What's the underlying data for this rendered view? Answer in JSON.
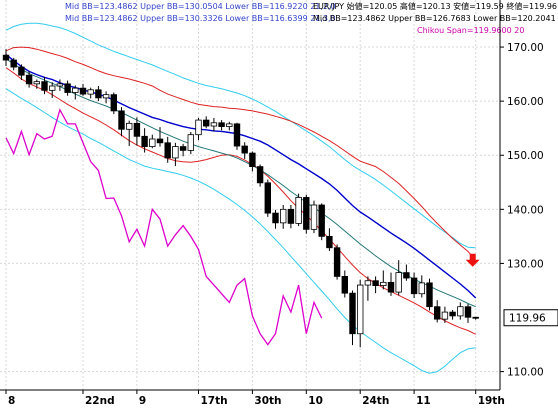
{
  "chart_data": {
    "type": "candlestick",
    "colors": {
      "background": "#ffffff",
      "grid": "#d8d8d8",
      "mid_bb_20": "#0000cc",
      "bb_20_band": "#dd2222",
      "mid_bb_21": "#227777",
      "bb_21_band": "#33ccee",
      "chikou": "#dd00cc",
      "up_candle": "#ffffff",
      "down_candle": "#000000",
      "current_price_box": "#000000",
      "arrow": "#ee1111"
    },
    "header_lines": [
      {
        "text": "Mid BB=123.4862 Upper BB=130.0504 Lower BB=116.9220  21,2,0",
        "color": "#3344cc"
      },
      {
        "text": "Mid BB=123.4862 Upper BB=130.3326 Lower BB=116.6399  21,3,0",
        "color": "#3344cc"
      },
      {
        "text": "EUR/JPY 始値=120.05 高値=120.13 安値=119.59 終値=119.96",
        "color": "#000000"
      },
      {
        "text": "Mid BB=123.4862 Upper BB=126.7683 Lower BB=120.2041  21,1,0",
        "color": "#000000"
      },
      {
        "text": "Chikou Span=119.9600  20",
        "color": "#cc00aa"
      }
    ],
    "y_ticks": [
      170,
      160,
      150,
      140,
      130,
      110
    ],
    "y_tick_labels": [
      "170.00",
      "160.00",
      "150.00",
      "140.00",
      "130.00",
      "110.00"
    ],
    "y_range": [
      106.6,
      178.7
    ],
    "current_price_label": "119.96",
    "current_price": 119.96,
    "x_labels": [
      {
        "i": 0,
        "label": "8"
      },
      {
        "i": 10,
        "label": "22nd"
      },
      {
        "i": 17,
        "label": "9"
      },
      {
        "i": 25,
        "label": "17th"
      },
      {
        "i": 32,
        "label": "30th"
      },
      {
        "i": 39,
        "label": "10"
      },
      {
        "i": 46,
        "label": "24th"
      },
      {
        "i": 53,
        "label": "11"
      },
      {
        "i": 61,
        "label": "19th"
      }
    ],
    "candles": [
      {
        "o": 168.5,
        "h": 169.6,
        "l": 166.5,
        "c": 167.6
      },
      {
        "o": 167.6,
        "h": 168.0,
        "l": 165.7,
        "c": 166.3
      },
      {
        "o": 166.3,
        "h": 166.8,
        "l": 163.9,
        "c": 164.8
      },
      {
        "o": 164.8,
        "h": 165.5,
        "l": 162.5,
        "c": 163.2
      },
      {
        "o": 163.2,
        "h": 164.0,
        "l": 162.3,
        "c": 163.6
      },
      {
        "o": 163.6,
        "h": 164.5,
        "l": 161.3,
        "c": 162.0
      },
      {
        "o": 162.0,
        "h": 163.5,
        "l": 160.6,
        "c": 162.8
      },
      {
        "o": 162.8,
        "h": 164.0,
        "l": 161.9,
        "c": 163.2
      },
      {
        "o": 163.2,
        "h": 163.8,
        "l": 161.0,
        "c": 161.6
      },
      {
        "o": 161.6,
        "h": 162.9,
        "l": 160.3,
        "c": 162.4
      },
      {
        "o": 162.4,
        "h": 163.2,
        "l": 161.0,
        "c": 161.3
      },
      {
        "o": 161.3,
        "h": 162.5,
        "l": 160.5,
        "c": 162.1
      },
      {
        "o": 162.1,
        "h": 162.8,
        "l": 160.0,
        "c": 160.6
      },
      {
        "o": 160.6,
        "h": 161.8,
        "l": 159.6,
        "c": 161.2
      },
      {
        "o": 161.2,
        "h": 161.6,
        "l": 157.6,
        "c": 158.2
      },
      {
        "o": 158.2,
        "h": 158.9,
        "l": 153.5,
        "c": 154.8
      },
      {
        "o": 154.8,
        "h": 156.4,
        "l": 151.7,
        "c": 155.9
      },
      {
        "o": 155.9,
        "h": 157.0,
        "l": 151.8,
        "c": 153.5
      },
      {
        "o": 153.5,
        "h": 155.0,
        "l": 150.5,
        "c": 151.6
      },
      {
        "o": 151.6,
        "h": 153.8,
        "l": 151.3,
        "c": 153.0
      },
      {
        "o": 153.0,
        "h": 155.2,
        "l": 151.6,
        "c": 152.3
      },
      {
        "o": 152.3,
        "h": 153.4,
        "l": 148.6,
        "c": 149.5
      },
      {
        "o": 149.5,
        "h": 152.3,
        "l": 148.0,
        "c": 151.6
      },
      {
        "o": 151.6,
        "h": 152.1,
        "l": 149.8,
        "c": 150.9
      },
      {
        "o": 150.9,
        "h": 154.3,
        "l": 150.2,
        "c": 153.8
      },
      {
        "o": 153.8,
        "h": 156.9,
        "l": 152.8,
        "c": 156.5
      },
      {
        "o": 156.5,
        "h": 157.2,
        "l": 155.0,
        "c": 155.4
      },
      {
        "o": 155.4,
        "h": 156.9,
        "l": 154.4,
        "c": 156.0
      },
      {
        "o": 156.0,
        "h": 156.5,
        "l": 154.6,
        "c": 155.3
      },
      {
        "o": 155.3,
        "h": 156.2,
        "l": 154.6,
        "c": 155.8
      },
      {
        "o": 155.8,
        "h": 156.0,
        "l": 151.0,
        "c": 151.7
      },
      {
        "o": 151.7,
        "h": 152.4,
        "l": 149.3,
        "c": 150.4
      },
      {
        "o": 150.4,
        "h": 150.7,
        "l": 147.0,
        "c": 147.9
      },
      {
        "o": 147.9,
        "h": 148.3,
        "l": 144.2,
        "c": 144.9
      },
      {
        "o": 144.9,
        "h": 145.5,
        "l": 138.6,
        "c": 139.3
      },
      {
        "o": 139.3,
        "h": 139.9,
        "l": 136.4,
        "c": 137.5
      },
      {
        "o": 137.5,
        "h": 140.8,
        "l": 136.4,
        "c": 140.0
      },
      {
        "o": 140.0,
        "h": 140.8,
        "l": 136.5,
        "c": 137.4
      },
      {
        "o": 137.4,
        "h": 142.9,
        "l": 136.9,
        "c": 142.2
      },
      {
        "o": 142.2,
        "h": 142.7,
        "l": 135.5,
        "c": 136.3
      },
      {
        "o": 136.3,
        "h": 141.6,
        "l": 135.6,
        "c": 140.8
      },
      {
        "o": 140.8,
        "h": 141.1,
        "l": 134.3,
        "c": 135.0
      },
      {
        "o": 135.0,
        "h": 136.5,
        "l": 132.3,
        "c": 132.9
      },
      {
        "o": 132.9,
        "h": 133.5,
        "l": 127.0,
        "c": 127.6
      },
      {
        "o": 127.6,
        "h": 128.7,
        "l": 123.7,
        "c": 124.5
      },
      {
        "o": 124.5,
        "h": 125.0,
        "l": 114.9,
        "c": 117.0
      },
      {
        "o": 117.0,
        "h": 127.0,
        "l": 114.5,
        "c": 126.0
      },
      {
        "o": 126.0,
        "h": 127.6,
        "l": 123.1,
        "c": 126.8
      },
      {
        "o": 126.8,
        "h": 127.6,
        "l": 124.5,
        "c": 125.9
      },
      {
        "o": 125.9,
        "h": 128.7,
        "l": 125.2,
        "c": 126.5
      },
      {
        "o": 126.5,
        "h": 128.3,
        "l": 124.0,
        "c": 124.7
      },
      {
        "o": 124.7,
        "h": 130.6,
        "l": 124.1,
        "c": 128.3
      },
      {
        "o": 128.3,
        "h": 129.8,
        "l": 126.8,
        "c": 127.3
      },
      {
        "o": 127.3,
        "h": 128.3,
        "l": 123.6,
        "c": 124.4
      },
      {
        "o": 124.4,
        "h": 127.8,
        "l": 123.7,
        "c": 126.4
      },
      {
        "o": 126.4,
        "h": 127.2,
        "l": 121.3,
        "c": 122.0
      },
      {
        "o": 122.0,
        "h": 123.2,
        "l": 119.1,
        "c": 119.7
      },
      {
        "o": 119.7,
        "h": 122.0,
        "l": 119.0,
        "c": 121.0
      },
      {
        "o": 121.0,
        "h": 121.4,
        "l": 119.6,
        "c": 120.3
      },
      {
        "o": 120.3,
        "h": 122.8,
        "l": 119.6,
        "c": 122.0
      },
      {
        "o": 122.0,
        "h": 122.5,
        "l": 119.0,
        "c": 120.05
      },
      {
        "o": 120.05,
        "h": 120.13,
        "l": 119.59,
        "c": 119.96
      }
    ],
    "mid_bb_20": [
      168.6,
      167.5,
      166.4,
      165.5,
      164.9,
      164.4,
      164.0,
      163.4,
      162.9,
      162.5,
      162.1,
      161.7,
      161.3,
      160.8,
      160.2,
      159.5,
      158.8,
      158.2,
      157.6,
      157.0,
      156.6,
      156.1,
      155.7,
      155.3,
      155.0,
      154.8,
      154.7,
      154.5,
      154.4,
      154.2,
      154.0,
      153.6,
      153.1,
      152.6,
      151.9,
      151.0,
      150.1,
      149.2,
      148.4,
      147.5,
      146.6,
      145.7,
      144.7,
      143.5,
      142.1,
      140.7,
      139.5,
      138.6,
      137.6,
      136.6,
      135.6,
      134.7,
      133.8,
      132.8,
      131.7,
      130.6,
      129.5,
      128.4,
      127.3,
      126.2,
      125.0,
      123.6
    ],
    "upper_bb_20": [
      169.3,
      169.9,
      170.0,
      169.9,
      169.6,
      169.2,
      168.8,
      168.4,
      167.9,
      167.3,
      166.8,
      166.2,
      165.6,
      165.1,
      164.7,
      164.4,
      164.1,
      163.7,
      163.3,
      162.8,
      162.0,
      161.3,
      160.8,
      160.3,
      159.8,
      159.4,
      159.2,
      159.0,
      158.9,
      158.7,
      158.6,
      158.4,
      158.2,
      157.9,
      157.6,
      157.2,
      156.8,
      156.3,
      155.7,
      155.0,
      154.3,
      153.5,
      152.7,
      151.8,
      150.8,
      149.8,
      148.9,
      148.4,
      147.9,
      147.0,
      145.9,
      144.8,
      143.4,
      142.0,
      140.5,
      138.9,
      137.4,
      136.0,
      134.6,
      133.4,
      132.2,
      130.6
    ],
    "lower_bb_20": [
      166.2,
      165.2,
      164.1,
      163.3,
      162.6,
      162.0,
      161.2,
      160.3,
      159.4,
      158.6,
      157.8,
      157.1,
      156.4,
      155.6,
      154.7,
      153.7,
      152.7,
      151.9,
      151.2,
      150.6,
      150.0,
      149.4,
      149.0,
      148.8,
      148.7,
      148.9,
      149.2,
      149.6,
      150.0,
      150.1,
      149.8,
      149.1,
      148.3,
      147.3,
      146.1,
      144.7,
      143.2,
      141.6,
      140.2,
      138.9,
      137.5,
      136.0,
      134.5,
      132.9,
      131.3,
      129.7,
      128.3,
      127.2,
      126.3,
      125.5,
      124.8,
      124.1,
      123.4,
      122.7,
      121.9,
      121.0,
      120.2,
      119.4,
      118.7,
      118.1,
      117.6,
      116.9
    ],
    "mid_bb_21": [
      167.8,
      166.9,
      165.9,
      165.1,
      164.5,
      163.9,
      163.3,
      162.7,
      162.0,
      161.3,
      160.7,
      160.1,
      159.6,
      159.1,
      158.5,
      157.9,
      157.2,
      156.5,
      155.8,
      155.1,
      154.4,
      153.8,
      153.2,
      152.6,
      152.1,
      151.6,
      151.2,
      150.8,
      150.4,
      150.0,
      149.5,
      148.8,
      148.1,
      147.3,
      146.4,
      145.4,
      144.4,
      143.3,
      142.3,
      141.3,
      140.3,
      139.3,
      138.3,
      137.2,
      136.0,
      134.8,
      133.6,
      132.5,
      131.4,
      130.4,
      129.4,
      128.6,
      127.8,
      127.1,
      126.4,
      125.8,
      125.1,
      124.5,
      123.9,
      123.3,
      122.6,
      122.0
    ],
    "upper_bb_21": [
      173.1,
      173.8,
      174.2,
      174.4,
      174.4,
      174.2,
      173.9,
      173.6,
      173.1,
      172.5,
      171.8,
      171.1,
      170.4,
      169.8,
      169.2,
      168.7,
      168.2,
      167.7,
      167.2,
      166.7,
      166.1,
      165.5,
      164.9,
      164.3,
      163.8,
      163.3,
      162.9,
      162.6,
      162.3,
      161.9,
      161.5,
      161.0,
      160.4,
      159.7,
      158.9,
      158.1,
      157.2,
      156.3,
      155.4,
      154.5,
      153.6,
      152.6,
      151.6,
      150.4,
      149.2,
      148.1,
      147.2,
      146.4,
      145.5,
      144.5,
      143.4,
      142.3,
      141.2,
      140.1,
      139.0,
      137.9,
      136.8,
      135.8,
      134.8,
      133.7,
      133.0,
      132.9
    ],
    "lower_bb_21": [
      162.3,
      161.4,
      160.5,
      159.7,
      158.8,
      157.9,
      157.0,
      156.1,
      155.3,
      154.6,
      153.9,
      153.1,
      152.4,
      151.6,
      150.8,
      150.0,
      149.2,
      148.6,
      148.0,
      147.6,
      147.3,
      147.0,
      146.7,
      146.3,
      145.8,
      145.2,
      144.5,
      143.7,
      142.8,
      141.9,
      140.9,
      139.8,
      138.6,
      137.3,
      135.9,
      134.4,
      132.9,
      131.3,
      129.7,
      128.1,
      126.5,
      124.9,
      123.3,
      121.6,
      120.0,
      118.6,
      117.4,
      116.4,
      115.4,
      114.4,
      113.5,
      112.7,
      111.9,
      111.1,
      110.2,
      109.7,
      110.0,
      111.0,
      112.3,
      113.5,
      114.2,
      114.4
    ],
    "chikou": [
      153.2,
      150.3,
      154.4,
      150.1,
      154.0,
      153.0,
      153.5,
      158.4,
      155.8,
      155.8,
      152.3,
      148.8,
      147.2,
      142.0,
      142.1,
      138.8,
      134.0,
      136.3,
      133.2,
      140.0,
      138.2,
      133.2,
      135.3,
      137.0,
      135.0,
      132.6,
      127.6,
      126.0,
      124.4,
      122.8,
      126.0,
      127.2,
      120.3,
      117.0,
      115.0,
      117.0,
      124.0,
      121.0,
      126.0,
      117.0,
      122.8,
      119.9
    ]
  }
}
